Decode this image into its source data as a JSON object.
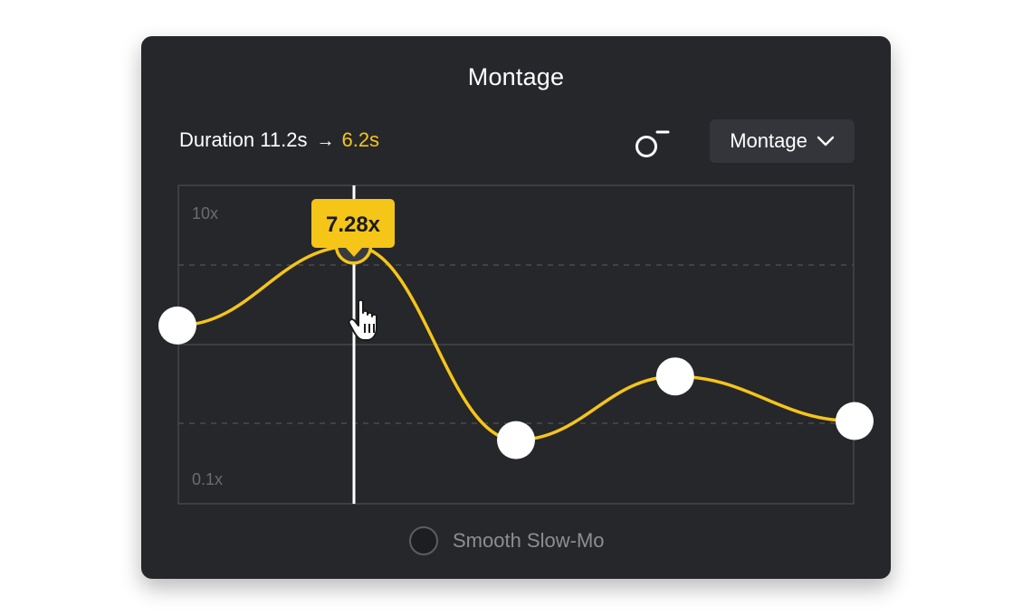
{
  "panel": {
    "title": "Montage"
  },
  "duration": {
    "label": "Duration",
    "original": "11.2s",
    "arrow": "→",
    "new": "6.2s"
  },
  "toolbar": {
    "reset_icon": "reset-speed-icon",
    "preset_dropdown": {
      "selected": "Montage",
      "icon": "chevron-down-icon"
    }
  },
  "speed_graph": {
    "y_max_label": "10x",
    "y_min_label": "0.1x",
    "tooltip_value": "7.28x",
    "active_point_index": 1,
    "control_points": [
      {
        "t": 0.0,
        "level": 0.56
      },
      {
        "t": 0.26,
        "level": 0.81
      },
      {
        "t": 0.5,
        "level": 0.2
      },
      {
        "t": 0.735,
        "level": 0.4
      },
      {
        "t": 1.0,
        "level": 0.26
      }
    ],
    "colors": {
      "curve": "#f5c518",
      "point": "#ffffff",
      "active_point_fill": "#3a3b3f",
      "playhead": "#ffffff",
      "grid": "#45464b",
      "tooltip_bg": "#f5c518"
    }
  },
  "smooth_slowmo": {
    "label": "Smooth Slow-Mo",
    "checked": false
  }
}
